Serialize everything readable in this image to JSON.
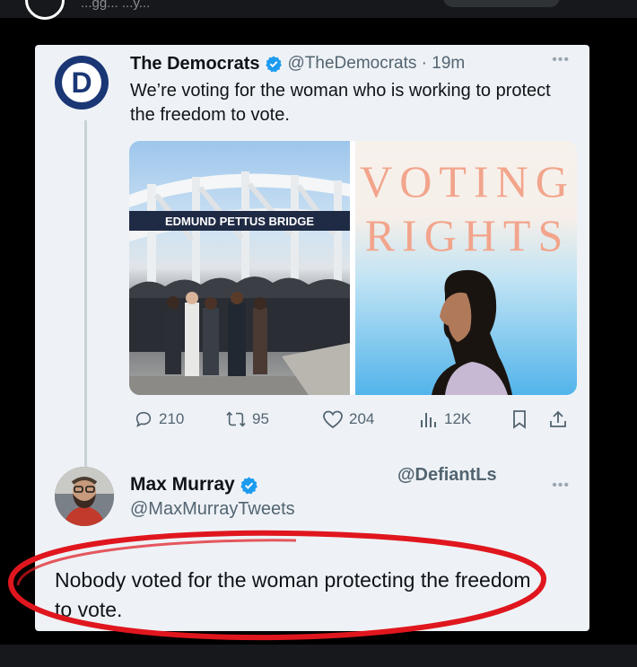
{
  "top_bar": {
    "ghost_text": "...gg... ...y..."
  },
  "tweet": {
    "author_name": "The Democrats",
    "handle_time": "@TheDemocrats · 19m",
    "avatar_letter": "D",
    "text": "We’re voting for the woman who is working to protect the freedom to vote.",
    "media": [
      {
        "sign_text": "EDMUND PETTUS BRIDGE"
      },
      {
        "sign_text_line1": "VOTING",
        "sign_text_line2": "RIGHTS"
      }
    ],
    "stats": {
      "replies": "210",
      "reposts": "95",
      "likes": "204",
      "views": "12K"
    }
  },
  "reply": {
    "author_name": "Max Murray",
    "handle": "@MaxMurrayTweets",
    "watermark": "@DefiantLs",
    "text": "Nobody voted for the woman protecting the freedom to vote."
  },
  "colors": {
    "verified": "#1d9bf0",
    "highlight": "#e0161e",
    "dem_blue": "#1a3675",
    "card_bg": "#eef2f6"
  },
  "icons": [
    "reply-icon",
    "repost-icon",
    "like-icon",
    "views-icon",
    "bookmark-icon",
    "share-icon",
    "verified-badge-icon",
    "more-icon"
  ]
}
